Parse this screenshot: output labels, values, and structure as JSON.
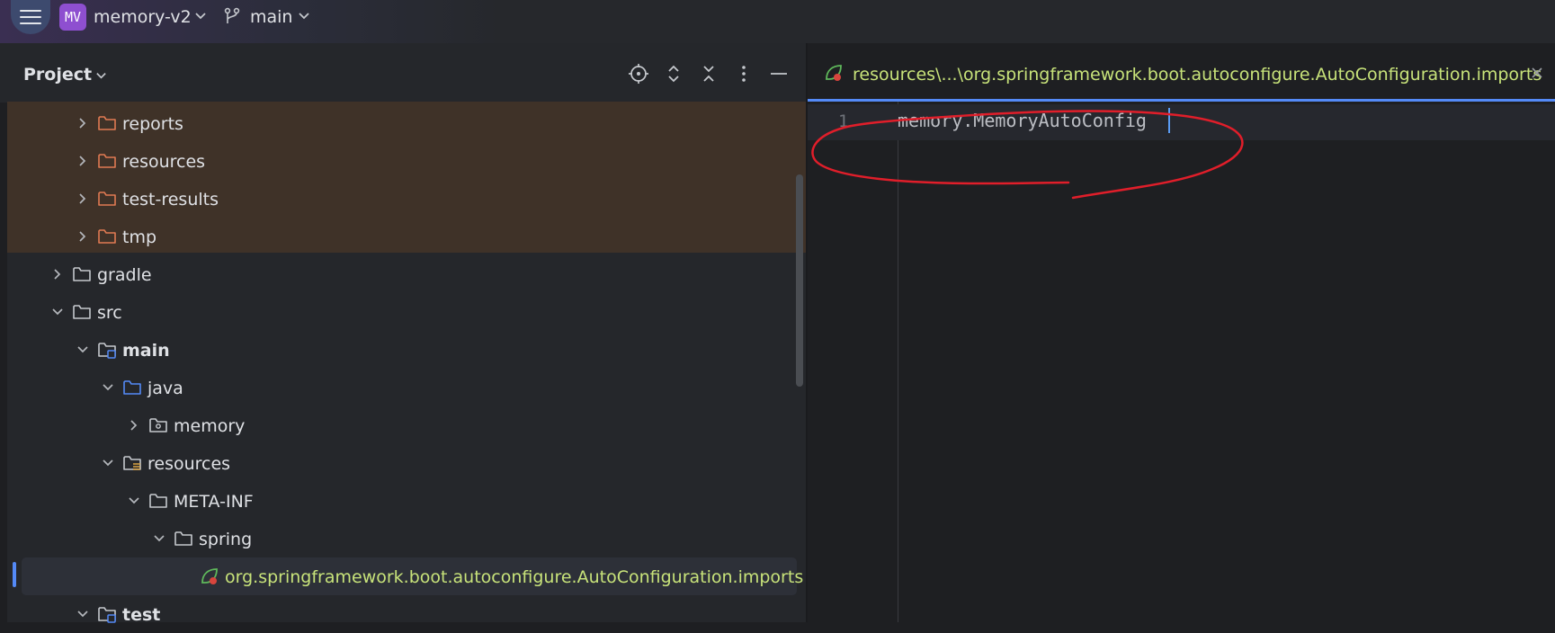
{
  "titlebar": {
    "project_badge": "MV",
    "project_name": "memory-v2",
    "branch": "main"
  },
  "project_panel": {
    "title": "Project",
    "tree": [
      {
        "label": "reports",
        "expanded": false,
        "folder_style": "excluded"
      },
      {
        "label": "resources",
        "expanded": false,
        "folder_style": "excluded"
      },
      {
        "label": "test-results",
        "expanded": false,
        "folder_style": "excluded"
      },
      {
        "label": "tmp",
        "expanded": false,
        "folder_style": "excluded"
      },
      {
        "label": "gradle",
        "expanded": false,
        "folder_style": "plain"
      },
      {
        "label": "src",
        "expanded": true,
        "folder_style": "plain"
      },
      {
        "label": "main",
        "expanded": true,
        "folder_style": "module"
      },
      {
        "label": "java",
        "expanded": true,
        "folder_style": "source"
      },
      {
        "label": "memory",
        "expanded": false,
        "folder_style": "package"
      },
      {
        "label": "resources",
        "expanded": true,
        "folder_style": "resources"
      },
      {
        "label": "META-INF",
        "expanded": true,
        "folder_style": "plain"
      },
      {
        "label": "spring",
        "expanded": true,
        "folder_style": "plain"
      },
      {
        "label": "org.springframework.boot.autoconfigure.AutoConfiguration.imports",
        "selected": true,
        "folder_style": "spring-file"
      },
      {
        "label": "test",
        "expanded": true,
        "folder_style": "module"
      }
    ]
  },
  "editor": {
    "tab_label": "resources\\...\\org.springframework.boot.autoconfigure.AutoConfiguration.imports",
    "lines": [
      {
        "number": "1",
        "text": "memory.MemoryAutoConfig"
      }
    ]
  },
  "colors": {
    "accent": "#548af7",
    "excluded_bg": "#3f3228",
    "excluded_folder": "#e07a52",
    "modified_file_text": "#c8e37a",
    "annotation": "#e01e2a",
    "project_badge": "#8e4fd0"
  }
}
